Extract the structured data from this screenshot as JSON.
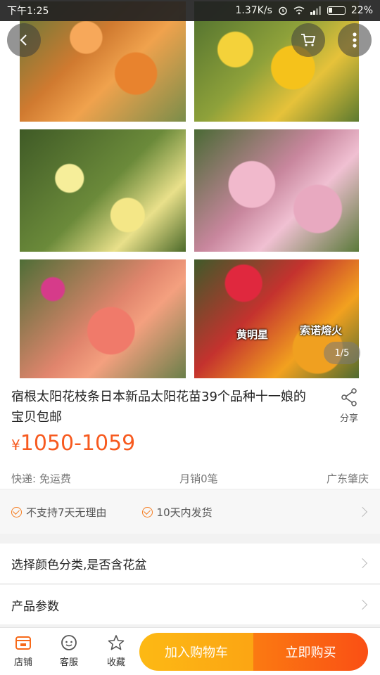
{
  "status_bar": {
    "time": "下午1:25",
    "net_speed": "1.37K/s",
    "battery": "22%"
  },
  "gallery": {
    "page_indicator": "1/5",
    "photo_label_1": "黄明星",
    "photo_label_2": "索诺熔火"
  },
  "product": {
    "title": "宿根太阳花枝条日本新品太阳花苗39个品种十一娘的宝贝包邮",
    "share_label": "分享",
    "price_symbol": "¥",
    "price": "1050-1059",
    "shipping": "快递: 免运费",
    "monthly_sales": "月销0笔",
    "location": "广东肇庆"
  },
  "guarantees": [
    "不支持7天无理由",
    "10天内发货"
  ],
  "options": {
    "select_color": "选择颜色分类,是否含花盆",
    "product_params": "产品参数"
  },
  "bottom_bar": {
    "shop": "店铺",
    "service": "客服",
    "favorite": "收藏",
    "add_to_cart": "加入购物车",
    "buy_now": "立即购买"
  },
  "colors": {
    "accent": "#f75a1f",
    "cart_button": "#fdb914",
    "buy_button": "#fa5514"
  }
}
